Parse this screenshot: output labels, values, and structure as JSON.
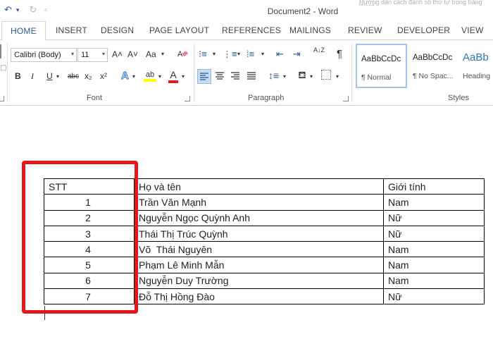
{
  "window": {
    "title": "Document2 - Word",
    "faded_text": "Hướng dẫn cách đánh số thứ tự trong bảng Word"
  },
  "quick_access": {
    "save_icon": "undo-icon",
    "undo_label": "↶",
    "undo_drop": "▾",
    "redo_label": "↻",
    "customize_label": "⩡"
  },
  "tabs": [
    {
      "label": "HOME",
      "active": true
    },
    {
      "label": "INSERT"
    },
    {
      "label": "DESIGN"
    },
    {
      "label": "PAGE LAYOUT"
    },
    {
      "label": "REFERENCES"
    },
    {
      "label": "MAILINGS"
    },
    {
      "label": "REVIEW"
    },
    {
      "label": "DEVELOPER"
    },
    {
      "label": "VIEW"
    }
  ],
  "ribbon": {
    "font": {
      "group_label": "Font",
      "font_name": "Calibri (Body)",
      "font_size": "11",
      "grow": "A˄",
      "shrink": "A˅",
      "case": "Aa",
      "bold": "B",
      "italic": "I",
      "underline": "U",
      "strike": "abc",
      "subscript": "x₂",
      "superscript": "x²",
      "text_effects": "A",
      "highlight": "ab",
      "font_color": "A"
    },
    "paragraph": {
      "group_label": "Paragraph",
      "sort": "A↓Z",
      "show_marks": "¶"
    },
    "styles": {
      "group_label": "Styles",
      "items": [
        {
          "sample": "AaBbCcDc",
          "name": "¶ Normal"
        },
        {
          "sample": "AaBbCcDc",
          "name": "¶ No Spac..."
        },
        {
          "sample": "AaBb",
          "name": "Heading"
        }
      ]
    }
  },
  "table": {
    "headers": [
      "STT",
      "Họ và tên",
      "Giới tính"
    ],
    "rows": [
      [
        "1",
        "Trần Văn Mạnh",
        "Nam"
      ],
      [
        "2",
        "Nguyễn Ngọc Quỳnh Anh",
        "Nữ"
      ],
      [
        "3",
        "Thái Thị Trúc Quỳnh",
        "Nữ"
      ],
      [
        "4",
        "Võ  Thái Nguyên",
        "Nam"
      ],
      [
        "5",
        "Phạm Lê Minh Mẫn",
        "Nam"
      ],
      [
        "6",
        "Nguyễn Duy Trường",
        "Nam"
      ],
      [
        "7",
        "Đỗ Thị Hồng Đào",
        "Nữ"
      ]
    ]
  },
  "colors": {
    "accent": "#2b579a",
    "highlight_box": "#e6161b"
  }
}
